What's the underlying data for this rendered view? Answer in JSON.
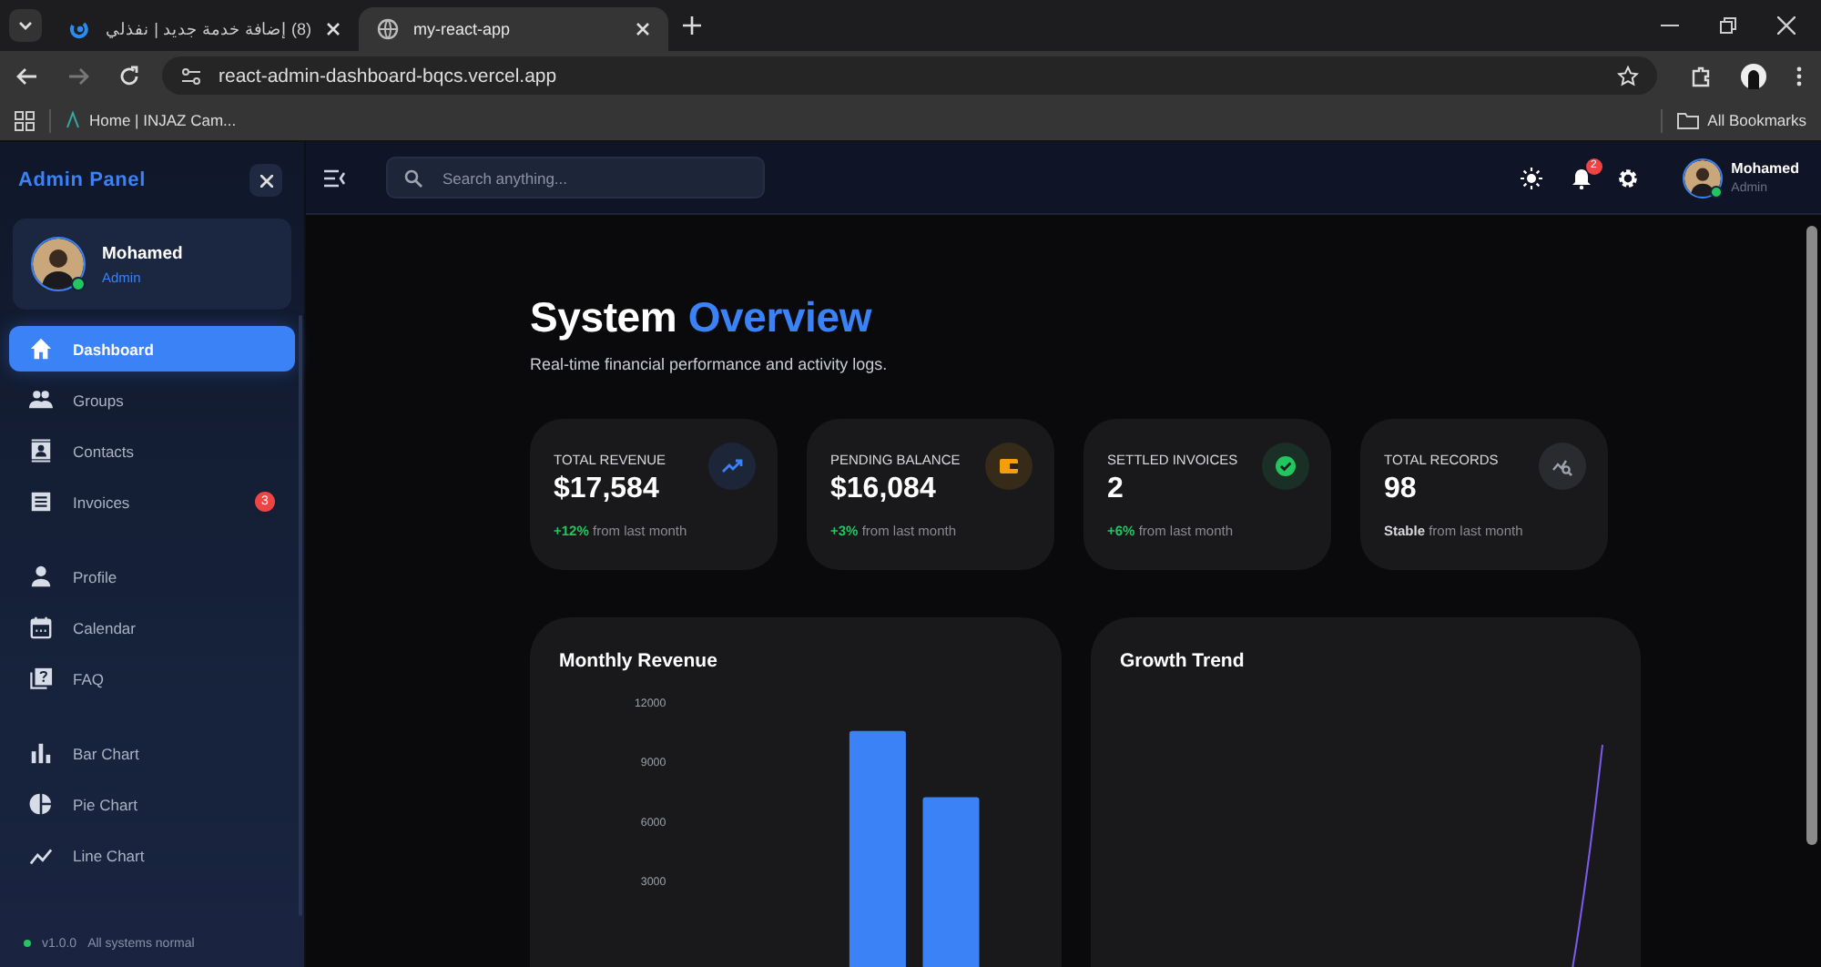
{
  "browser": {
    "tabs": [
      {
        "title": "(8) إضافة خدمة جديد | نفذلي",
        "selected": false
      },
      {
        "title": "my-react-app",
        "selected": true
      }
    ],
    "url": "react-admin-dashboard-bqcs.vercel.app",
    "bookmarks": [
      "Home | INJAZ Cam..."
    ],
    "all_bookmarks": "All Bookmarks"
  },
  "sidebar": {
    "title": "Admin Panel",
    "user": {
      "name": "Mohamed",
      "role": "Admin",
      "online": true
    },
    "sections": [
      [
        {
          "label": "Dashboard",
          "selected": true
        },
        {
          "label": "Groups",
          "selected": false
        },
        {
          "label": "Contacts",
          "selected": false
        },
        {
          "label": "Invoices",
          "selected": false,
          "badge": "3"
        }
      ],
      [
        {
          "label": "Profile",
          "selected": false
        },
        {
          "label": "Calendar",
          "selected": false
        },
        {
          "label": "FAQ",
          "selected": false
        }
      ],
      [
        {
          "label": "Bar Chart",
          "selected": false
        },
        {
          "label": "Pie Chart",
          "selected": false
        },
        {
          "label": "Line Chart",
          "selected": false
        }
      ]
    ],
    "version": "v1.0.0",
    "status": "All systems normal"
  },
  "topbar": {
    "search_placeholder": "Search anything...",
    "notifications": "2",
    "user": {
      "name": "Mohamed",
      "role": "Admin",
      "online": true
    }
  },
  "header": {
    "title": "System",
    "title_highlight": "Overview",
    "subtitle": "Real-time financial performance and activity logs."
  },
  "stats": [
    {
      "label": "TOTAL REVENUE",
      "value": "$17,584",
      "change": "+12%",
      "kind": "positive",
      "note": "from last month",
      "color": "#3b82f6"
    },
    {
      "label": "PENDING BALANCE",
      "value": "$16,084",
      "change": "+3%",
      "kind": "positive",
      "note": "from last month",
      "color": "#f59e0b"
    },
    {
      "label": "SETTLED INVOICES",
      "value": "2",
      "change": "+6%",
      "kind": "positive",
      "note": "from last month",
      "color": "#22c55e"
    },
    {
      "label": "TOTAL RECORDS",
      "value": "98",
      "change": "Stable",
      "kind": "neutral",
      "note": "from last month",
      "color": "#9ca3af"
    }
  ],
  "charts": [
    {
      "title": "Monthly Revenue",
      "kind": "bars",
      "axis_labels": [
        "12000",
        "9000",
        "6000",
        "3000"
      ]
    },
    {
      "title": "Growth Trend"
    }
  ]
}
